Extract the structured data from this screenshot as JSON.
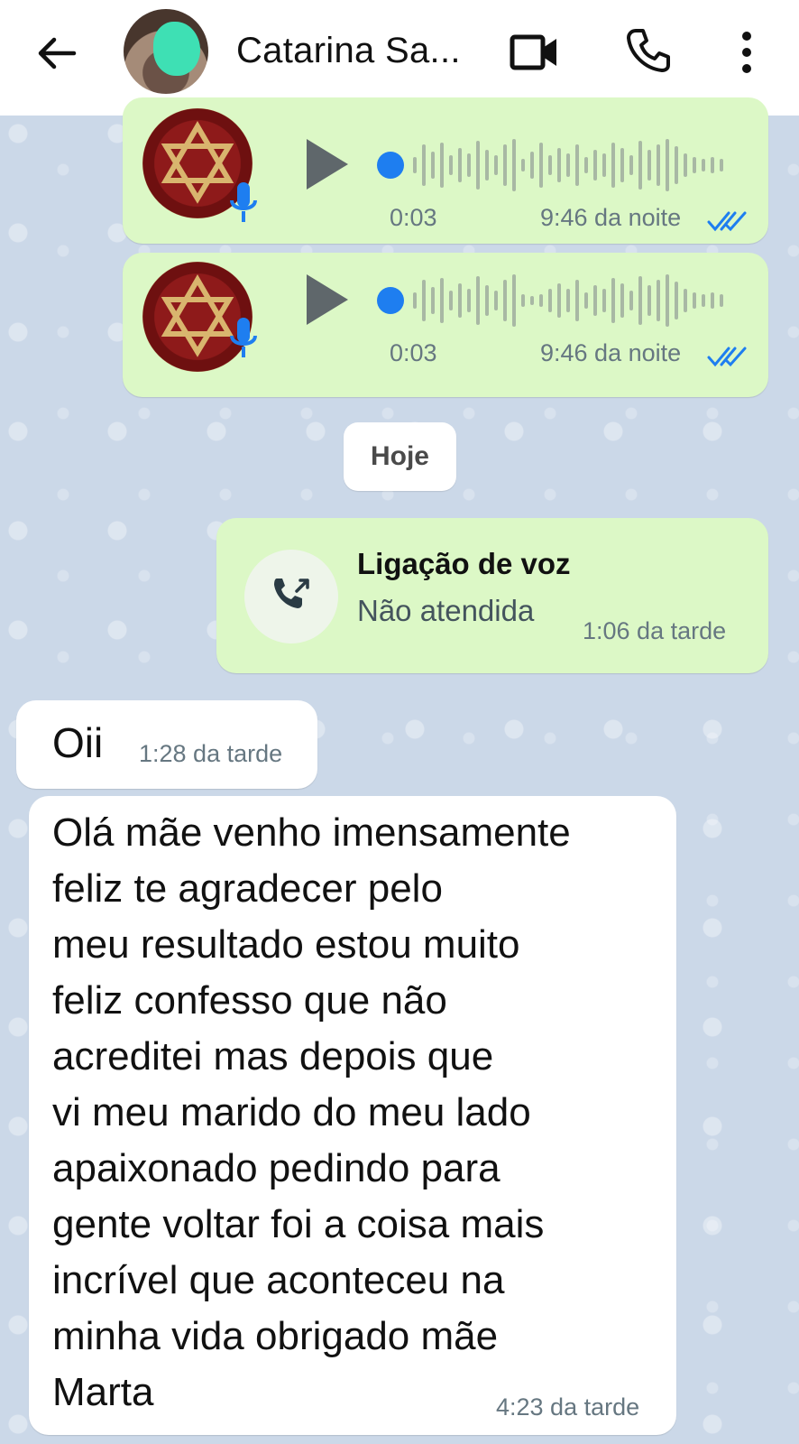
{
  "header": {
    "contact_name": "Catarina Sa...",
    "back_icon": "back-arrow-icon",
    "video_icon": "video-camera-icon",
    "call_icon": "phone-icon",
    "menu_icon": "more-vertical-icon"
  },
  "messages": [
    {
      "type": "voice",
      "duration": "0:03",
      "time": "9:46 da noite",
      "status": "read"
    },
    {
      "type": "voice",
      "duration": "0:03",
      "time": "9:46 da noite",
      "status": "read"
    }
  ],
  "date_divider": "Hoje",
  "call_message": {
    "title": "Ligação de voz",
    "subtitle": "Não atendida",
    "time": "1:06 da tarde"
  },
  "incoming": [
    {
      "text": "Oii",
      "time": "1:28 da tarde"
    },
    {
      "lines": [
        "Olá mãe venho imensamente",
        "feliz te agradecer pelo",
        "meu resultado estou muito",
        "feliz confesso que não",
        "acreditei mas depois que",
        "vi meu marido do meu lado",
        "apaixonado pedindo para",
        "gente voltar foi a coisa mais",
        "incrível que aconteceu na",
        "minha vida obrigado mãe",
        "Marta"
      ],
      "time": "4:23 da tarde"
    }
  ],
  "colors": {
    "outgoing_bubble": "#dcf8c6",
    "incoming_bubble": "#ffffff",
    "read_ticks": "#1e7ef0",
    "chat_background": "#cbd8e8"
  }
}
